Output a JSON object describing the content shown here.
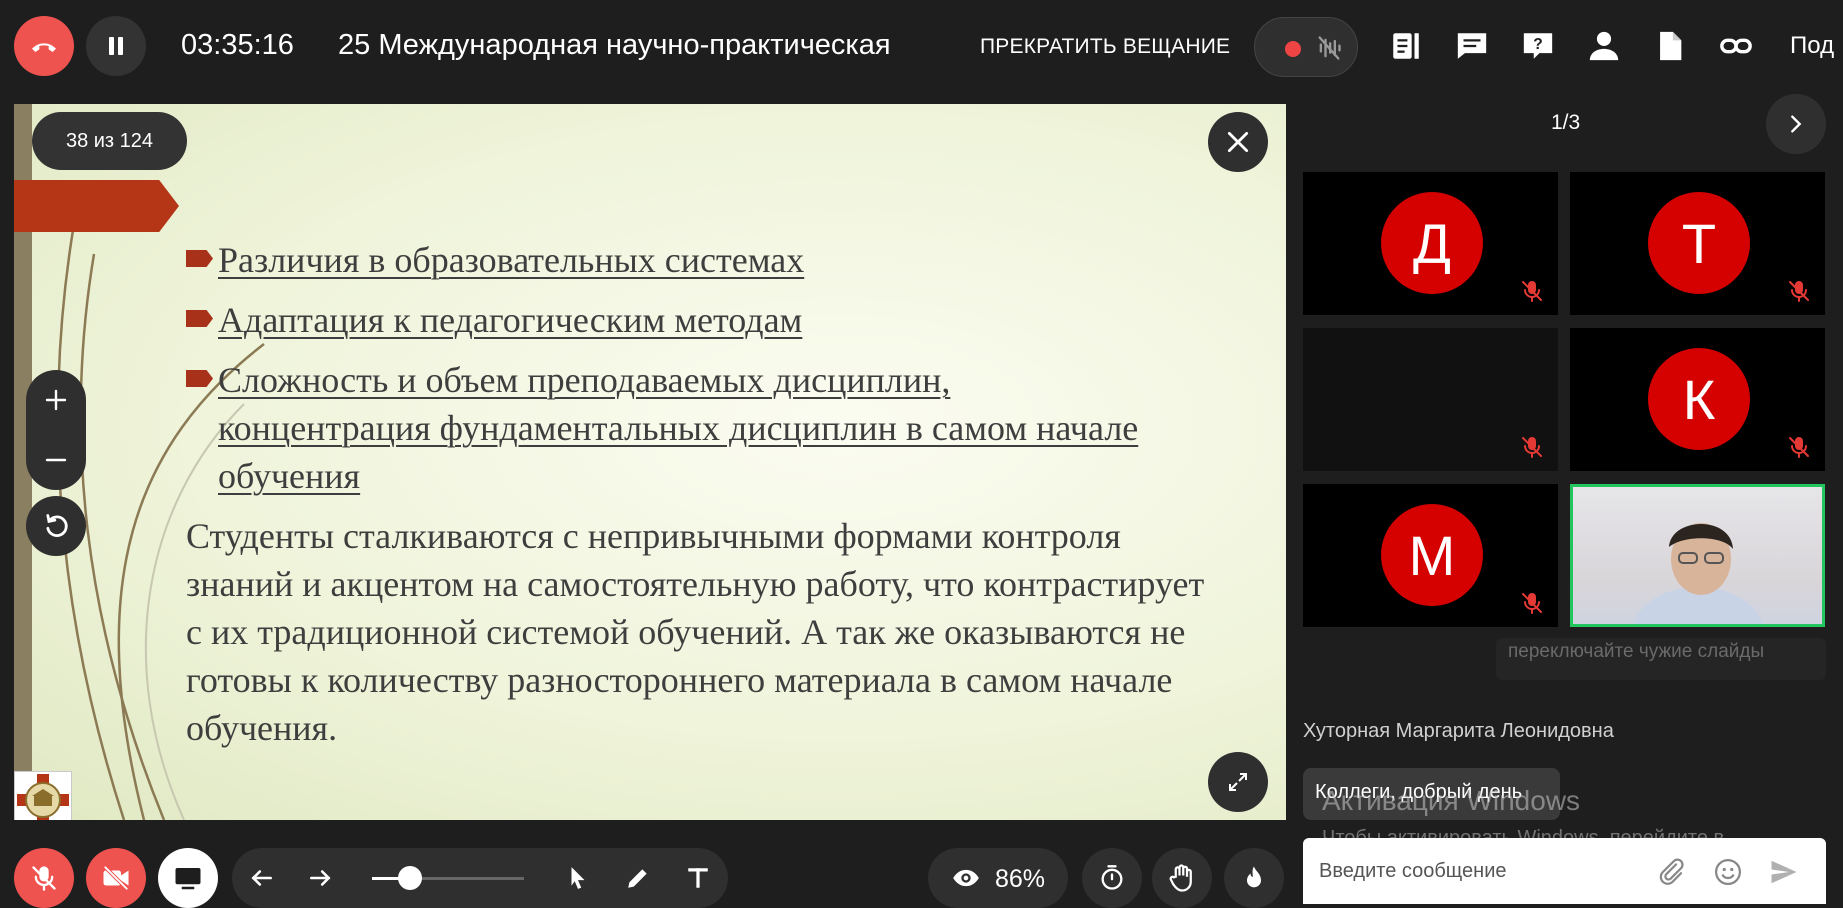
{
  "topbar": {
    "timer": "03:35:16",
    "title": "25 Международная научно-практическая",
    "stop_broadcast": "ПРЕКРАТИТЬ ВЕЩАНИЕ",
    "more": "Под"
  },
  "slide": {
    "counter": "38 из 124",
    "bullets": [
      "Различия в образовательных системах",
      "Адаптация к педагогическим методам",
      "Сложность и объем преподаваемых дисциплин, концентрация фундаментальных дисциплин в самом начале обучения"
    ],
    "paragraph": "Студенты сталкиваются с непривычными формами контроля знаний и акцентом на самостоятельную работу, что контрастирует с их традиционной системой обучений. А так же оказываются не готовы к количеству разностороннего материала в самом начале обучения."
  },
  "participants": {
    "page": "1/3",
    "tiles": [
      {
        "initial": "Д",
        "muted": true
      },
      {
        "initial": "Т",
        "muted": true
      },
      {
        "initial": "",
        "muted": true
      },
      {
        "initial": "К",
        "muted": true
      },
      {
        "initial": "М",
        "muted": true
      }
    ]
  },
  "chat": {
    "ghost_message": "переключайте чужие слайды",
    "author": "Хуторная Маргарита Леонидовна",
    "message": "Коллеги, добрый день",
    "input_placeholder": "Введите сообщение"
  },
  "watermark": {
    "title": "Активация Windows",
    "text": "Чтобы активировать Windows, перейдите в раздел \"Параметры\"."
  },
  "toolbar": {
    "zoom_percent": "86%",
    "slider_level": 0.25
  },
  "colors": {
    "accent_red": "#ef5350",
    "avatar_red": "#d50000",
    "active_speaker": "#22c55e",
    "slide_bullet": "#a8311a"
  }
}
